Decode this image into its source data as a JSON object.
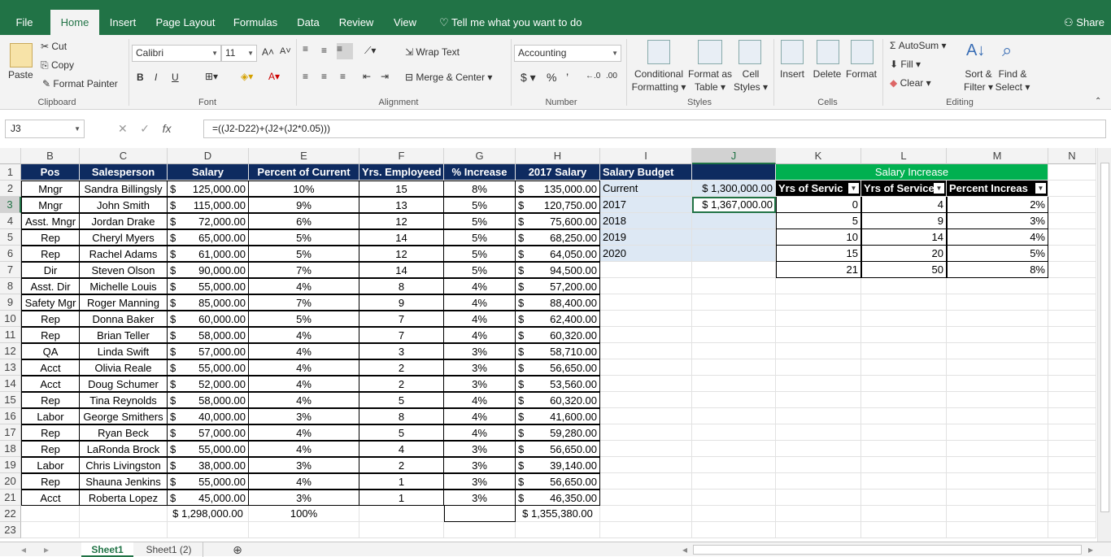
{
  "menu": {
    "tabs": [
      "File",
      "Home",
      "Insert",
      "Page Layout",
      "Formulas",
      "Data",
      "Review",
      "View"
    ],
    "active": "Home",
    "tell_me": "Tell me what you want to do",
    "share": "Share"
  },
  "ribbon": {
    "clipboard": {
      "paste": "Paste",
      "cut": "Cut",
      "copy": "Copy",
      "format_painter": "Format Painter",
      "label": "Clipboard"
    },
    "font": {
      "name": "Calibri",
      "size": "11",
      "label": "Font",
      "bold": "B",
      "italic": "I",
      "underline": "U",
      "grow": "A˄",
      "shrink": "A˅"
    },
    "alignment": {
      "wrap": "Wrap Text",
      "merge": "Merge & Center",
      "label": "Alignment"
    },
    "number": {
      "format": "Accounting",
      "currency": "$",
      "percent": "%",
      "comma": "’",
      "label": "Number"
    },
    "styles": {
      "conditional": "Conditional",
      "conditional2": "Formatting",
      "format_as": "Format as",
      "format_as2": "Table",
      "cell": "Cell",
      "cell2": "Styles",
      "label": "Styles"
    },
    "cells": {
      "insert": "Insert",
      "delete": "Delete",
      "format": "Format",
      "label": "Cells"
    },
    "editing": {
      "autosum": "AutoSum",
      "fill": "Fill",
      "clear": "Clear",
      "sort": "Sort &",
      "sort2": "Filter",
      "find": "Find &",
      "find2": "Select",
      "label": "Editing"
    }
  },
  "formula_bar": {
    "name_box": "J3",
    "fx": "fx",
    "formula": "=((J2-D22)+(J2+(J2*0.05)))"
  },
  "columns": [
    "B",
    "C",
    "D",
    "E",
    "F",
    "G",
    "H",
    "I",
    "J",
    "K",
    "L",
    "M",
    "N"
  ],
  "selected_col": "J",
  "selected_row": "3",
  "rows": [
    "1",
    "2",
    "3",
    "4",
    "5",
    "6",
    "7",
    "8",
    "9",
    "10",
    "11",
    "12",
    "13",
    "14",
    "15",
    "16",
    "17",
    "18",
    "19",
    "20",
    "21",
    "22",
    "23"
  ],
  "headers": [
    "Pos",
    "Salesperson",
    "Salary",
    "Percent of Current",
    "Yrs. Employeed",
    "% Increase",
    "2017 Salary"
  ],
  "employees": [
    [
      "Mngr",
      "Sandra Billingsly",
      "125,000.00",
      "10%",
      "15",
      "8%",
      "135,000.00"
    ],
    [
      "Mngr",
      "John Smith",
      "115,000.00",
      "9%",
      "13",
      "5%",
      "120,750.00"
    ],
    [
      "Asst. Mngr",
      "Jordan Drake",
      "72,000.00",
      "6%",
      "12",
      "5%",
      "75,600.00"
    ],
    [
      "Rep",
      "Cheryl Myers",
      "65,000.00",
      "5%",
      "14",
      "5%",
      "68,250.00"
    ],
    [
      "Rep",
      "Rachel Adams",
      "61,000.00",
      "5%",
      "12",
      "5%",
      "64,050.00"
    ],
    [
      "Dir",
      "Steven Olson",
      "90,000.00",
      "7%",
      "14",
      "5%",
      "94,500.00"
    ],
    [
      "Asst. Dir",
      "Michelle Louis",
      "55,000.00",
      "4%",
      "8",
      "4%",
      "57,200.00"
    ],
    [
      "Safety Mgr",
      "Roger Manning",
      "85,000.00",
      "7%",
      "9",
      "4%",
      "88,400.00"
    ],
    [
      "Rep",
      "Donna Baker",
      "60,000.00",
      "5%",
      "7",
      "4%",
      "62,400.00"
    ],
    [
      "Rep",
      "Brian Teller",
      "58,000.00",
      "4%",
      "7",
      "4%",
      "60,320.00"
    ],
    [
      "QA",
      "Linda Swift",
      "57,000.00",
      "4%",
      "3",
      "3%",
      "58,710.00"
    ],
    [
      "Acct",
      "Olivia Reale",
      "55,000.00",
      "4%",
      "2",
      "3%",
      "56,650.00"
    ],
    [
      "Acct",
      "Doug Schumer",
      "52,000.00",
      "4%",
      "2",
      "3%",
      "53,560.00"
    ],
    [
      "Rep",
      "Tina Reynolds",
      "58,000.00",
      "4%",
      "5",
      "4%",
      "60,320.00"
    ],
    [
      "Labor",
      "George Smithers",
      "40,000.00",
      "3%",
      "8",
      "4%",
      "41,600.00"
    ],
    [
      "Rep",
      "Ryan Beck",
      "57,000.00",
      "4%",
      "5",
      "4%",
      "59,280.00"
    ],
    [
      "Rep",
      "LaRonda Brock",
      "55,000.00",
      "4%",
      "4",
      "3%",
      "56,650.00"
    ],
    [
      "Labor",
      "Chris Livingston",
      "38,000.00",
      "3%",
      "2",
      "3%",
      "39,140.00"
    ],
    [
      "Rep",
      "Shauna Jenkins",
      "55,000.00",
      "4%",
      "1",
      "3%",
      "56,650.00"
    ],
    [
      "Acct",
      "Roberta Lopez",
      "45,000.00",
      "3%",
      "1",
      "3%",
      "46,350.00"
    ]
  ],
  "totals": {
    "salary": "$ 1,298,000.00",
    "percent": "100%",
    "salary2017": "$ 1,355,380.00"
  },
  "currency_symbol": "$",
  "budget": {
    "title": "Salary Budget",
    "labels": [
      "Current",
      "2017",
      "2018",
      "2019",
      "2020"
    ],
    "values": [
      "$ 1,300,000.00",
      "$ 1,367,000.00",
      "",
      "",
      ""
    ]
  },
  "increase": {
    "title": "Salary Increase",
    "headers": [
      "Yrs of Servic",
      "Yrs of Service",
      "Percent Increas"
    ],
    "rows": [
      [
        "0",
        "4",
        "2%"
      ],
      [
        "5",
        "9",
        "3%"
      ],
      [
        "10",
        "14",
        "4%"
      ],
      [
        "15",
        "20",
        "5%"
      ],
      [
        "21",
        "50",
        "8%"
      ]
    ]
  },
  "sheets": [
    "Sheet1",
    "Sheet1 (2)"
  ],
  "active_sheet": "Sheet1",
  "colors": {
    "excel_green": "#217346",
    "navy_header": "#0e2b60",
    "green_header": "#00b050",
    "budget_fill": "#dde8f4"
  }
}
